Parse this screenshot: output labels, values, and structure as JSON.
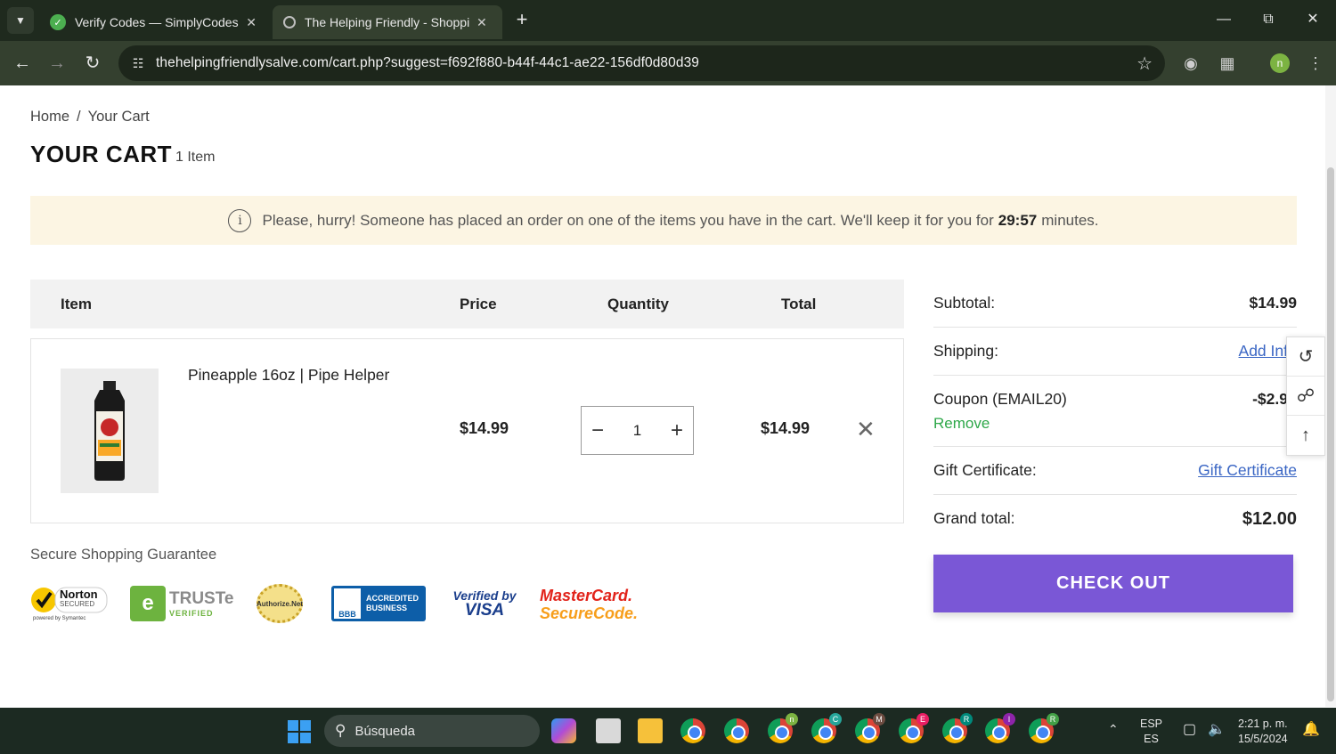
{
  "browser": {
    "tabs": [
      {
        "title": "Verify Codes — SimplyCodes"
      },
      {
        "title": "The Helping Friendly - Shopping"
      }
    ],
    "url": "thehelpingfriendlysalve.com/cart.php?suggest=f692f880-b44f-44c1-ae22-156df0d80d39",
    "profile_initial": "n"
  },
  "breadcrumb": {
    "home": "Home",
    "sep": "/",
    "current": "Your Cart"
  },
  "cart": {
    "title": "YOUR CART",
    "count": "1 Item",
    "notice_text": "Please, hurry! Someone has placed an order on one of the items you have in the cart. We'll keep it for you for",
    "notice_timer": "29:57",
    "notice_suffix": "minutes.",
    "columns": {
      "item": "Item",
      "price": "Price",
      "quantity": "Quantity",
      "total": "Total"
    },
    "items": [
      {
        "name": "Pineapple 16oz | Pipe Helper",
        "price": "$14.99",
        "quantity": "1",
        "total": "$14.99"
      }
    ]
  },
  "secure": {
    "title": "Secure Shopping Guarantee",
    "badges": {
      "norton": "Norton",
      "norton_sub": "SECURED",
      "norton_powered": "powered by Symantec",
      "truste": "TRUSTe",
      "truste_sub": "VERIFIED",
      "authorize": "Authorize.Net",
      "bbb_line1": "ACCREDITED",
      "bbb_line2": "BUSINESS",
      "bbb_logo": "BBB",
      "visa_top": "Verified by",
      "visa": "VISA",
      "mastercard": "MasterCard.",
      "securecode": "SecureCode."
    }
  },
  "summary": {
    "subtotal_label": "Subtotal:",
    "subtotal": "$14.99",
    "shipping_label": "Shipping:",
    "shipping_link": "Add Inf",
    "coupon_label": "Coupon (EMAIL20)",
    "coupon_value": "-$2.9",
    "coupon_remove": "Remove",
    "gift_label": "Gift Certificate:",
    "gift_link": "Gift Certificate",
    "grand_label": "Grand total:",
    "grand_total": "$12.00",
    "checkout": "CHECK OUT"
  },
  "taskbar": {
    "search": "Búsqueda",
    "lang1": "ESP",
    "lang2": "ES",
    "time": "2:21 p. m.",
    "date": "15/5/2024"
  },
  "colors": {
    "accent": "#7a57d6",
    "notice_bg": "#fcf5e3",
    "link": "#3a66c4",
    "remove": "#2fa84a"
  }
}
